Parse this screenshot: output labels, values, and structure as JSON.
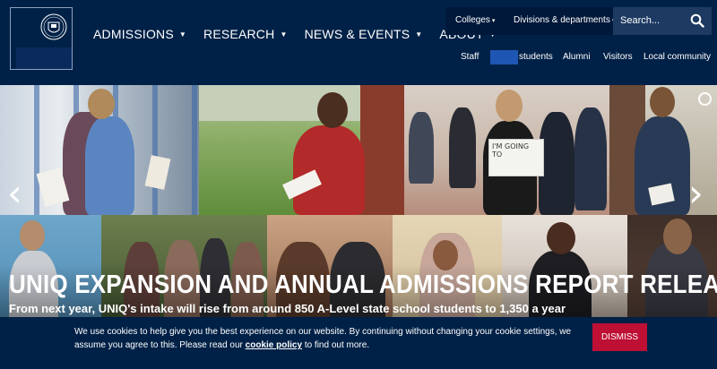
{
  "main_nav": [
    {
      "label": "ADMISSIONS"
    },
    {
      "label": "RESEARCH"
    },
    {
      "label": "NEWS & EVENTS"
    },
    {
      "label": "ABOUT"
    }
  ],
  "top_bar": {
    "colleges": "Colleges",
    "divisions": "Divisions & departments",
    "search_placeholder": "Search..."
  },
  "sub_nav": {
    "staff": "Staff",
    "students": "students",
    "alumni": "Alumni",
    "visitors": "Visitors",
    "local_community": "Local community"
  },
  "hero": {
    "headline": "UNIQ EXPANSION AND ANNUAL ADMISSIONS REPORT RELEASED",
    "subheadline": "From next year, UNIQ's intake will rise from around 850 A-Level state school students to 1,350 a year",
    "sign_text": "I'M GOING TO"
  },
  "cookie": {
    "text_before": "We use cookies to help give you the best experience on our website. By continuing without changing your cookie settings, we assume you agree to this. Please read our",
    "link": "cookie policy",
    "text_after": "to find out more.",
    "dismiss_label": "DISMISS"
  },
  "colors": {
    "navy": "#002147",
    "dismiss": "#be0f34",
    "highlight": "#1e56b3"
  }
}
